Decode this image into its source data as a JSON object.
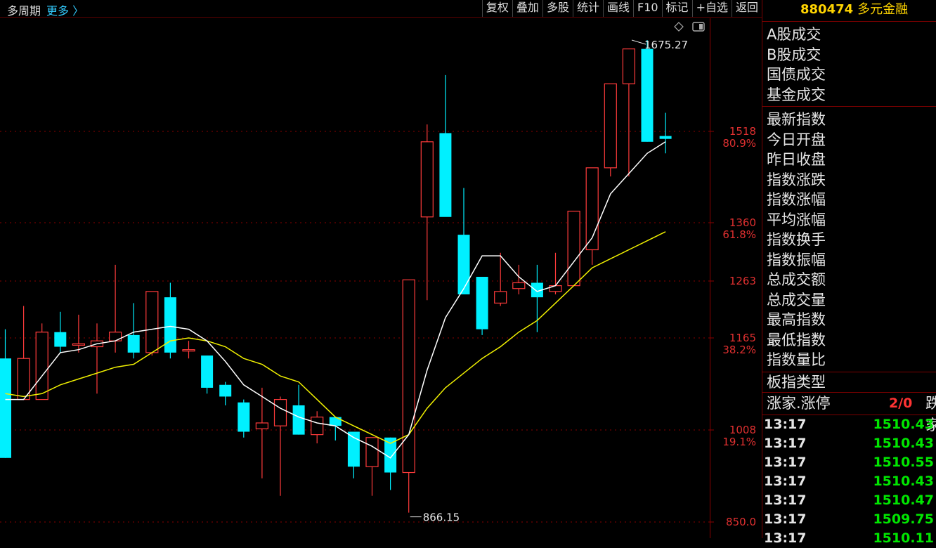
{
  "toolbar": {
    "period": "多周期",
    "more": "更多 〉",
    "buttons": [
      "复权",
      "叠加",
      "多股",
      "统计",
      "画线",
      "F10",
      "标记",
      "+自选",
      "返回"
    ]
  },
  "chart": {
    "y_axis": [
      {
        "value": "1518",
        "pct": "80.9%"
      },
      {
        "value": "1360",
        "pct": "61.8%"
      },
      {
        "value": "1263",
        "pct": ""
      },
      {
        "value": "1165",
        "pct": "38.2%"
      },
      {
        "value": "1008",
        "pct": "19.1%"
      },
      {
        "value": "850.0",
        "pct": ""
      }
    ],
    "high_label": "1675.27",
    "low_label": "866.15",
    "colors": {
      "up": "#ff3b3b",
      "down": "#00f0ff",
      "ma_short": "#ffffff",
      "ma_long": "#f0f000",
      "grid": "#8b0000"
    }
  },
  "chart_data": {
    "type": "candlestick",
    "ylim": [
      850.0,
      1690
    ],
    "candles": [
      {
        "o": 1130,
        "h": 1180,
        "l": 960,
        "c": 960
      },
      {
        "o": 1060,
        "h": 1220,
        "l": 1060,
        "c": 1130
      },
      {
        "o": 1060,
        "h": 1190,
        "l": 1060,
        "c": 1175
      },
      {
        "o": 1175,
        "h": 1210,
        "l": 1140,
        "c": 1150
      },
      {
        "o": 1155,
        "h": 1205,
        "l": 1140,
        "c": 1155
      },
      {
        "o": 1150,
        "h": 1190,
        "l": 1070,
        "c": 1160
      },
      {
        "o": 1160,
        "h": 1290,
        "l": 1140,
        "c": 1175
      },
      {
        "o": 1170,
        "h": 1225,
        "l": 1130,
        "c": 1140
      },
      {
        "o": 1140,
        "h": 1245,
        "l": 1135,
        "c": 1245
      },
      {
        "o": 1235,
        "h": 1260,
        "l": 1130,
        "c": 1140
      },
      {
        "o": 1145,
        "h": 1160,
        "l": 1130,
        "c": 1145
      },
      {
        "o": 1135,
        "h": 1135,
        "l": 1070,
        "c": 1080
      },
      {
        "o": 1085,
        "h": 1090,
        "l": 1050,
        "c": 1065
      },
      {
        "o": 1055,
        "h": 1060,
        "l": 995,
        "c": 1005
      },
      {
        "o": 1010,
        "h": 1080,
        "l": 925,
        "c": 1020
      },
      {
        "o": 1015,
        "h": 1065,
        "l": 895,
        "c": 1060
      },
      {
        "o": 1050,
        "h": 1085,
        "l": 1000,
        "c": 1000
      },
      {
        "o": 1000,
        "h": 1040,
        "l": 985,
        "c": 1030
      },
      {
        "o": 1030,
        "h": 1030,
        "l": 990,
        "c": 1015
      },
      {
        "o": 1005,
        "h": 1005,
        "l": 925,
        "c": 945
      },
      {
        "o": 945,
        "h": 995,
        "l": 895,
        "c": 995
      },
      {
        "o": 995,
        "h": 995,
        "l": 905,
        "c": 935
      },
      {
        "o": 935,
        "h": 1265,
        "l": 866.15,
        "c": 1265
      },
      {
        "o": 1370,
        "h": 1530,
        "l": 1230,
        "c": 1500
      },
      {
        "o": 1515,
        "h": 1615,
        "l": 1380,
        "c": 1370
      },
      {
        "o": 1340,
        "h": 1420,
        "l": 1250,
        "c": 1240
      },
      {
        "o": 1270,
        "h": 1270,
        "l": 1170,
        "c": 1180
      },
      {
        "o": 1225,
        "h": 1310,
        "l": 1220,
        "c": 1245
      },
      {
        "o": 1250,
        "h": 1290,
        "l": 1240,
        "c": 1260
      },
      {
        "o": 1260,
        "h": 1290,
        "l": 1175,
        "c": 1235
      },
      {
        "o": 1245,
        "h": 1310,
        "l": 1240,
        "c": 1255
      },
      {
        "o": 1255,
        "h": 1380,
        "l": 1255,
        "c": 1380
      },
      {
        "o": 1315,
        "h": 1410,
        "l": 1290,
        "c": 1455
      },
      {
        "o": 1455,
        "h": 1545,
        "l": 1440,
        "c": 1600
      },
      {
        "o": 1600,
        "h": 1660,
        "l": 1440,
        "c": 1660
      },
      {
        "o": 1660,
        "h": 1675.27,
        "l": 1500,
        "c": 1500
      },
      {
        "o": 1510,
        "h": 1550,
        "l": 1480,
        "c": 1505
      }
    ],
    "ma_short": [
      1060,
      1060,
      1100,
      1140,
      1145,
      1155,
      1160,
      1175,
      1180,
      1185,
      1180,
      1160,
      1125,
      1085,
      1065,
      1045,
      1030,
      1020,
      1015,
      995,
      980,
      960,
      1000,
      1110,
      1200,
      1250,
      1305,
      1305,
      1270,
      1245,
      1255,
      1295,
      1335,
      1410,
      1445,
      1480,
      1500
    ],
    "ma_long": [
      1070,
      1065,
      1070,
      1085,
      1095,
      1105,
      1115,
      1120,
      1140,
      1160,
      1165,
      1160,
      1150,
      1130,
      1120,
      1100,
      1090,
      1060,
      1030,
      1015,
      1000,
      985,
      1000,
      1045,
      1080,
      1105,
      1130,
      1150,
      1175,
      1195,
      1225,
      1255,
      1285,
      1300,
      1315,
      1330,
      1345
    ]
  },
  "panel": {
    "code": "880474",
    "name": "多元金融",
    "section1": [
      "A股成交",
      "B股成交",
      "国债成交",
      "基金成交"
    ],
    "section2": [
      "最新指数",
      "今日开盘",
      "昨日收盘",
      "指数涨跌",
      "指数涨幅",
      "平均涨幅",
      "指数换手",
      "指数振幅",
      "总成交额",
      "总成交量",
      "最高指数",
      "最低指数",
      "指数量比"
    ],
    "board_type": "板指类型",
    "updown_label": "涨家.涨停",
    "updown_ratio": "2/0",
    "down_label": "跌家",
    "ticks": [
      {
        "time": "13:17",
        "price": "1510.43"
      },
      {
        "time": "13:17",
        "price": "1510.43"
      },
      {
        "time": "13:17",
        "price": "1510.55"
      },
      {
        "time": "13:17",
        "price": "1510.43"
      },
      {
        "time": "13:17",
        "price": "1510.47"
      },
      {
        "time": "13:17",
        "price": "1509.75"
      },
      {
        "time": "13:17",
        "price": "1510.11"
      }
    ]
  }
}
